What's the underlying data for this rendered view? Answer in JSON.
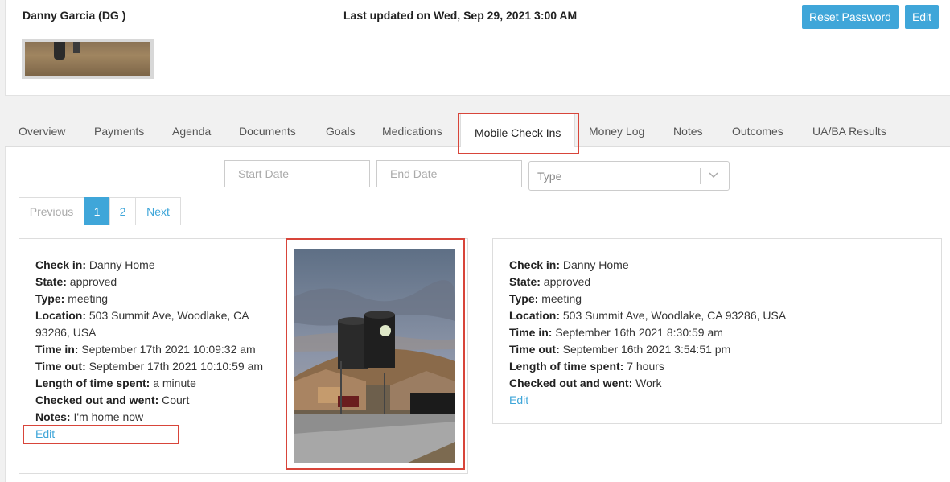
{
  "header": {
    "client_name": "Danny Garcia (DG )",
    "last_updated": "Last updated on Wed, Sep 29, 2021 3:00 AM",
    "reset_password_label": "Reset Password",
    "edit_label": "Edit"
  },
  "tabs": [
    {
      "label": "Overview"
    },
    {
      "label": "Payments"
    },
    {
      "label": "Agenda"
    },
    {
      "label": "Documents"
    },
    {
      "label": "Goals"
    },
    {
      "label": "Medications"
    },
    {
      "label": "Mobile Check Ins",
      "active": true
    },
    {
      "label": "Money Log"
    },
    {
      "label": "Notes"
    },
    {
      "label": "Outcomes"
    },
    {
      "label": "UA/BA Results"
    }
  ],
  "filters": {
    "start_date_placeholder": "Start Date",
    "end_date_placeholder": "End Date",
    "type_placeholder": "Type"
  },
  "pagination": {
    "previous": "Previous",
    "pages": [
      "1",
      "2"
    ],
    "current": "1",
    "next": "Next"
  },
  "checkins": [
    {
      "check_in_label": "Check in:",
      "check_in": "Danny Home",
      "state_label": "State:",
      "state": "approved",
      "type_label": "Type:",
      "type": "meeting",
      "location_label": "Location:",
      "location": "503 Summit Ave, Woodlake, CA 93286, USA",
      "time_in_label": "Time in:",
      "time_in": "September 17th 2021 10:09:32 am",
      "time_out_label": "Time out:",
      "time_out": "September 17th 2021 10:10:59 am",
      "length_label": "Length of time spent:",
      "length": "a minute",
      "went_label": "Checked out and went:",
      "went": "Court",
      "notes_label": "Notes:",
      "notes": "I'm home now",
      "edit_label": "Edit"
    },
    {
      "check_in_label": "Check in:",
      "check_in": "Danny Home",
      "state_label": "State:",
      "state": "approved",
      "type_label": "Type:",
      "type": "meeting",
      "location_label": "Location:",
      "location": "503 Summit Ave, Woodlake, CA 93286, USA",
      "time_in_label": "Time in:",
      "time_in": "September 16th 2021 8:30:59 am",
      "time_out_label": "Time out:",
      "time_out": "September 16th 2021 3:54:51 pm",
      "length_label": "Length of time spent:",
      "length": "7 hours",
      "went_label": "Checked out and went:",
      "went": "Work",
      "edit_label": "Edit"
    }
  ],
  "colors": {
    "accent": "#3fa6d9",
    "highlight": "#d8453a"
  }
}
